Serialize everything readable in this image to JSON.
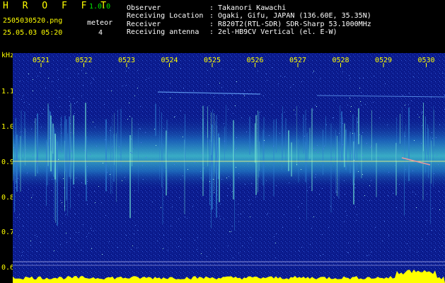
{
  "header": {
    "app_name": "H R O F F T",
    "version": "1.0.0",
    "filename": "2505030520.png",
    "timestamp": "25.05.03 05:20",
    "meteor_label": "meteor",
    "meteor_count": "4"
  },
  "info": {
    "rows": [
      {
        "label": "Observer",
        "sep": ":",
        "value": "Takanori Kawachi"
      },
      {
        "label": "Receiving Location",
        "sep": ":",
        "value": "Ogaki, Gifu, JAPAN (136.60E, 35.35N)"
      },
      {
        "label": "Receiver",
        "sep": ":",
        "value": "R820T2(RTL-SDR) SDR-Sharp 53.1000MHz"
      },
      {
        "label": "Receiving antenna",
        "sep": ":",
        "value": "2el-HB9CV Vertical (el. E-W)"
      }
    ]
  },
  "spectrogram": {
    "y_unit": "kHz",
    "y_ticks": [
      "1.1",
      "1.0",
      "0.9",
      "0.8",
      "0.7",
      "0.6"
    ],
    "x_ticks": [
      "0521",
      "0522",
      "0523",
      "0524",
      "0525",
      "0526",
      "0527",
      "0528",
      "0529",
      "0530"
    ],
    "colors": {
      "background": "#0a1a8c",
      "band": "#2fa8c8",
      "label_yellow": "#ffff00",
      "label_white": "#ffffff",
      "signal_line": "#ffff80",
      "power_bar": "#ffff00"
    }
  }
}
